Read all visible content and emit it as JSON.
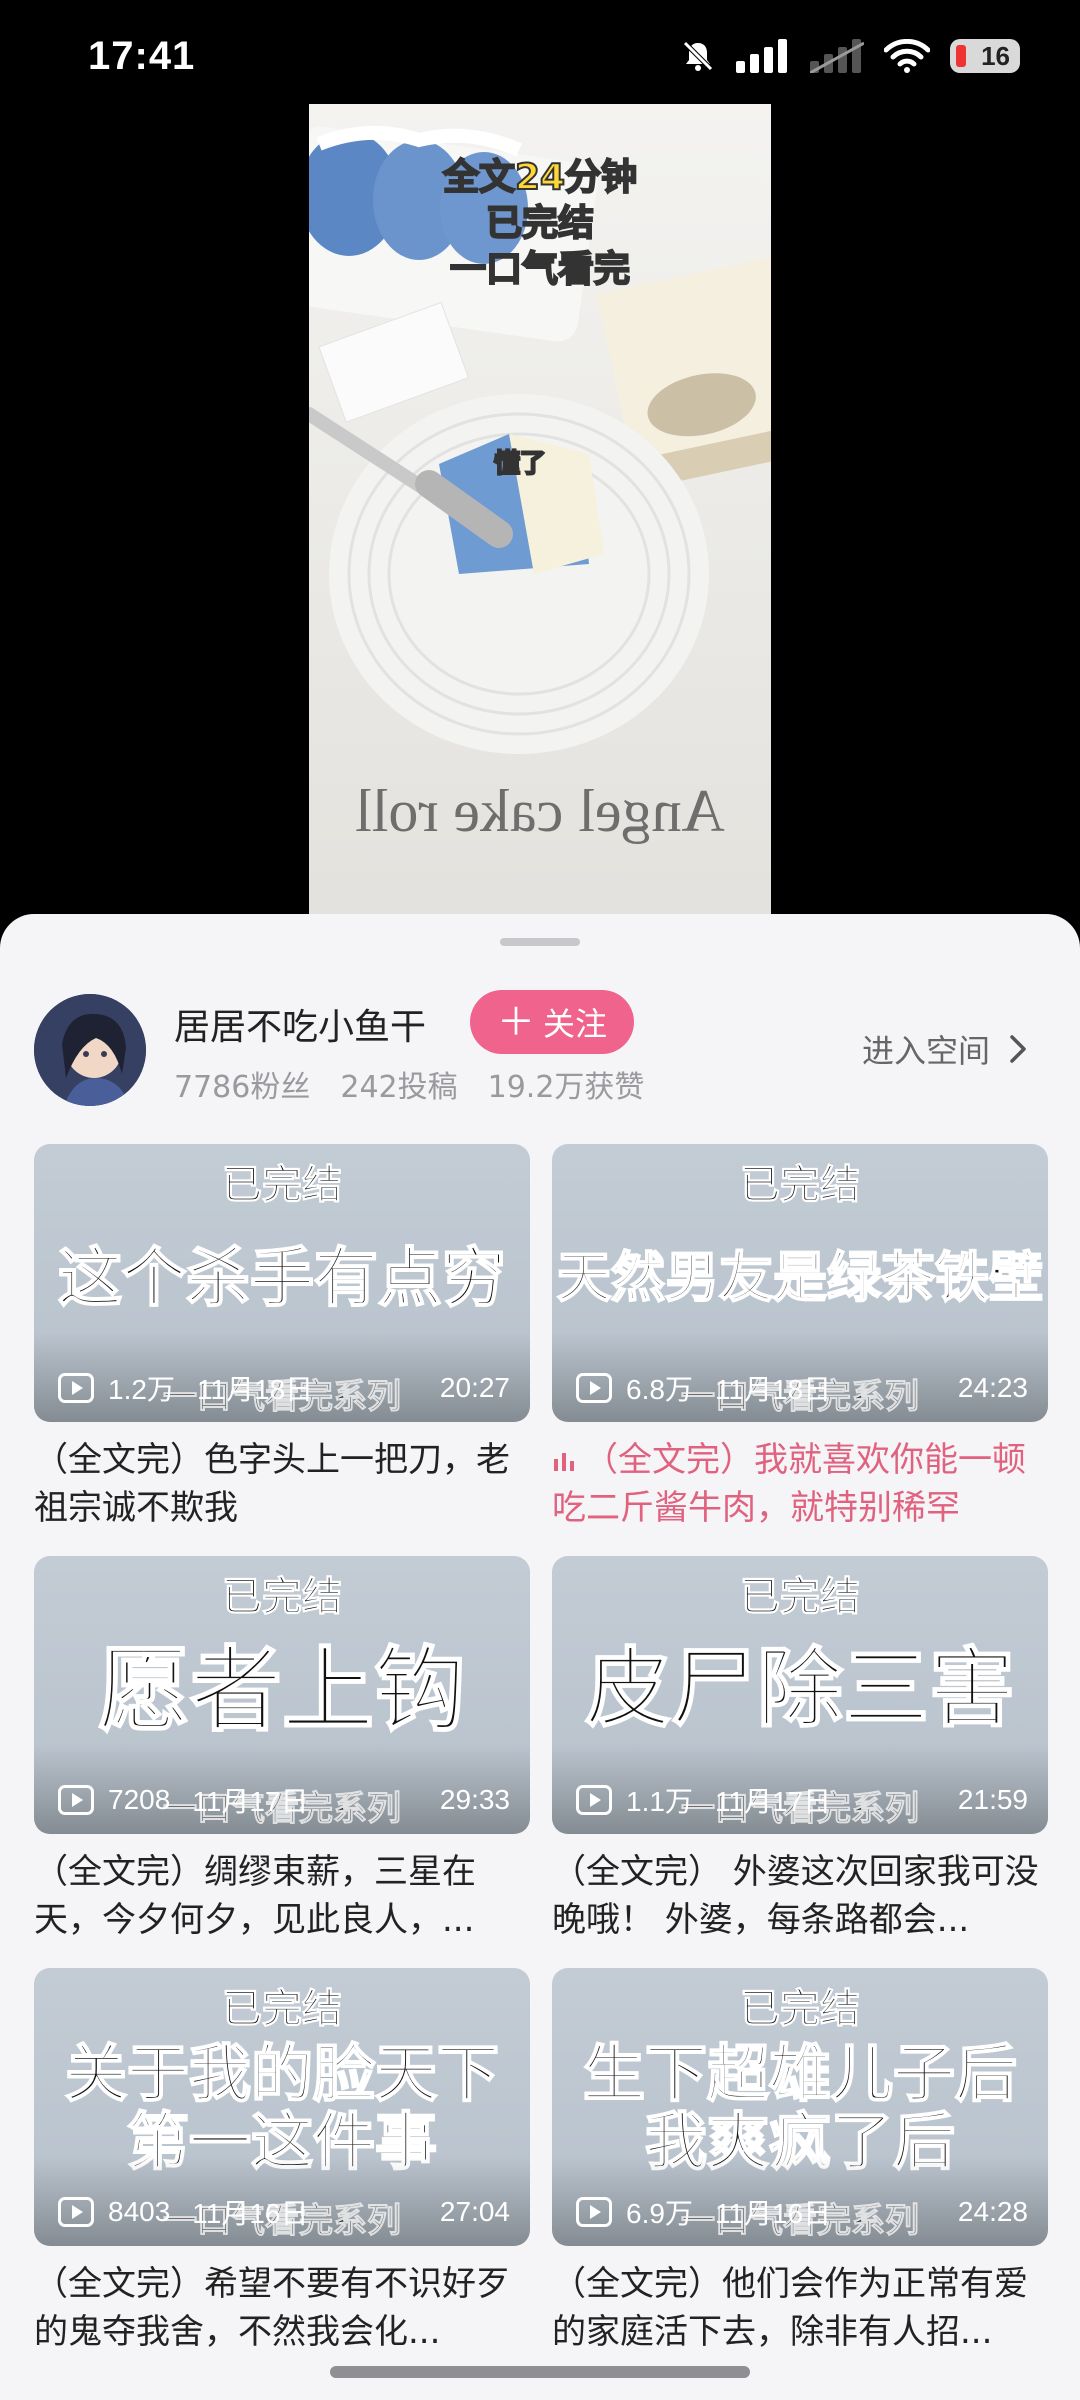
{
  "status_bar": {
    "time": "17:41",
    "battery": "16"
  },
  "video": {
    "caption_lines": [
      "全文24分钟",
      "已完结",
      "一口气看完"
    ],
    "sticker_text": "懂了",
    "watermark": "Angel cake roll"
  },
  "author": {
    "name": "居居不吃小鱼干",
    "follow_label": "关注",
    "fans": "7786粉丝",
    "posts": "242投稿",
    "likes": "19.2万获赞",
    "space_label": "进入空间"
  },
  "videos": [
    {
      "thumb_top": "已完结",
      "thumb_main": [
        "这个杀手有点穷"
      ],
      "thumb_bottom": "一口气看完系列",
      "views": "1.2万",
      "date": "11月18日",
      "duration": "20:27",
      "title": "（全文完）色字头上一把刀，老祖宗诚不欺我",
      "active": false
    },
    {
      "thumb_top": "已完结",
      "thumb_main": [
        "天然男友是绿茶铁壁"
      ],
      "thumb_bottom": "一口气看完系列",
      "views": "6.8万",
      "date": "11月18日",
      "duration": "24:23",
      "title": "（全文完）我就喜欢你能一顿吃二斤酱牛肉，就特别稀罕",
      "active": true
    },
    {
      "thumb_top": "已完结",
      "thumb_main": [
        "愿者上钩"
      ],
      "thumb_bottom": "一口气看完系列",
      "views": "7208",
      "date": "11月17日",
      "duration": "29:33",
      "title": "（全文完）绸缪束薪，三星在天，今夕何夕，见此良人，...",
      "active": false
    },
    {
      "thumb_top": "已完结",
      "thumb_main": [
        "皮尸除三害"
      ],
      "thumb_bottom": "一口气看完系列",
      "views": "1.1万",
      "date": "11月17日",
      "duration": "21:59",
      "title": "（全文完） 外婆这次回家我可没晚哦！ 外婆，每条路都会...",
      "active": false
    },
    {
      "thumb_top": "已完结",
      "thumb_main": [
        "关于我的脸天下",
        "第一这件事"
      ],
      "thumb_bottom": "一口气看完系列",
      "views": "8403",
      "date": "11月16日",
      "duration": "27:04",
      "title": "（全文完）希望不要有不识好歹的鬼夺我舍，不然我会化...",
      "active": false
    },
    {
      "thumb_top": "已完结",
      "thumb_main": [
        "生下超雄儿子后",
        "我爽疯了后"
      ],
      "thumb_bottom": "一口气看完系列",
      "views": "6.9万",
      "date": "11月16日",
      "duration": "24:28",
      "title": "（全文完）他们会作为正常有爱的家庭活下去，除非有人招...",
      "active": false
    }
  ]
}
